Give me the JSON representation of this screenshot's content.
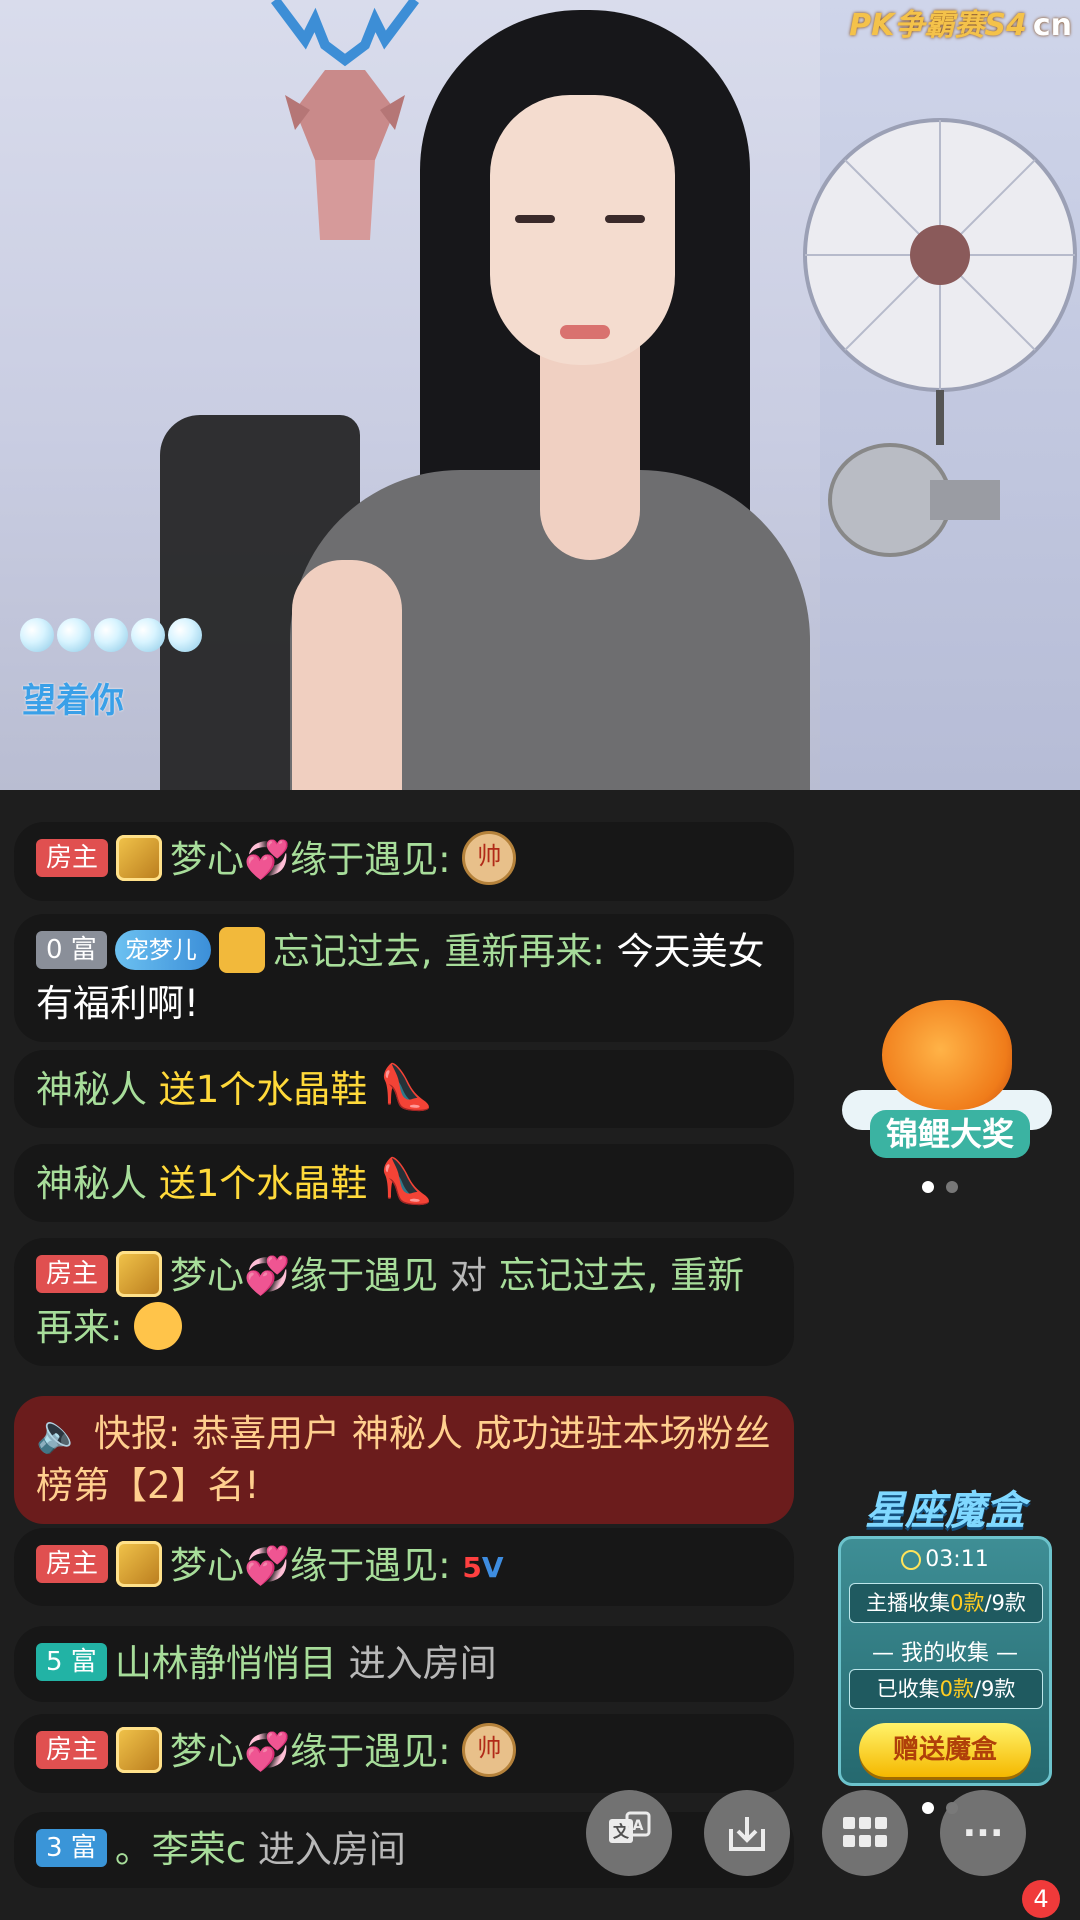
{
  "video": {
    "watermark": "PK争霸赛S4",
    "watermark_suffix": "cn",
    "caption": "望着你"
  },
  "chat": [
    {
      "badge": "房主",
      "badge_color": "#e05050",
      "user": "梦心💞缘于遇见:",
      "tail": "帅"
    },
    {
      "badge": "0 富",
      "badge_color": "#8a8f99",
      "tag": "宠梦儿",
      "user": "忘记过去, 重新再来:",
      "text": "今天美女有福利啊!"
    },
    {
      "user": "神秘人",
      "text": "送1个水晶鞋"
    },
    {
      "user": "神秘人",
      "text": "送1个水晶鞋"
    },
    {
      "badge": "房主",
      "user": "梦心💞缘于遇见",
      "mid": "对",
      "target": "忘记过去, 重新再来:"
    },
    {
      "alert": "快报: 恭喜用户 神秘人 成功进驻本场粉丝榜第【2】名!"
    },
    {
      "badge": "房主",
      "user": "梦心💞缘于遇见:",
      "tail": "5"
    },
    {
      "badge": "5 富",
      "badge_color": "#22b3a5",
      "user": "山林静悄悄目",
      "text": "进入房间"
    },
    {
      "badge": "房主",
      "user": "梦心💞缘于遇见:",
      "tail": "帅"
    },
    {
      "badge": "3 富",
      "badge_color": "#3a95d8",
      "user": "。李荣c",
      "text": "进入房间"
    }
  ],
  "koi": {
    "label": "锦鲤大奖"
  },
  "magic_box": {
    "title": "星座魔盒",
    "timer": "03:11",
    "anchor_prefix": "主播收集",
    "anchor_count": "0款",
    "anchor_total": "/9款",
    "mine_label": "— 我的收集 —",
    "mine_prefix": "已收集",
    "mine_count": "0款",
    "mine_total": "/9款",
    "button": "赠送魔盒"
  },
  "toolbar": {
    "translate_icon": "translate-icon",
    "download_icon": "download-icon",
    "grid_icon": "grid-icon",
    "more_label": "···",
    "notification_count": "4"
  }
}
